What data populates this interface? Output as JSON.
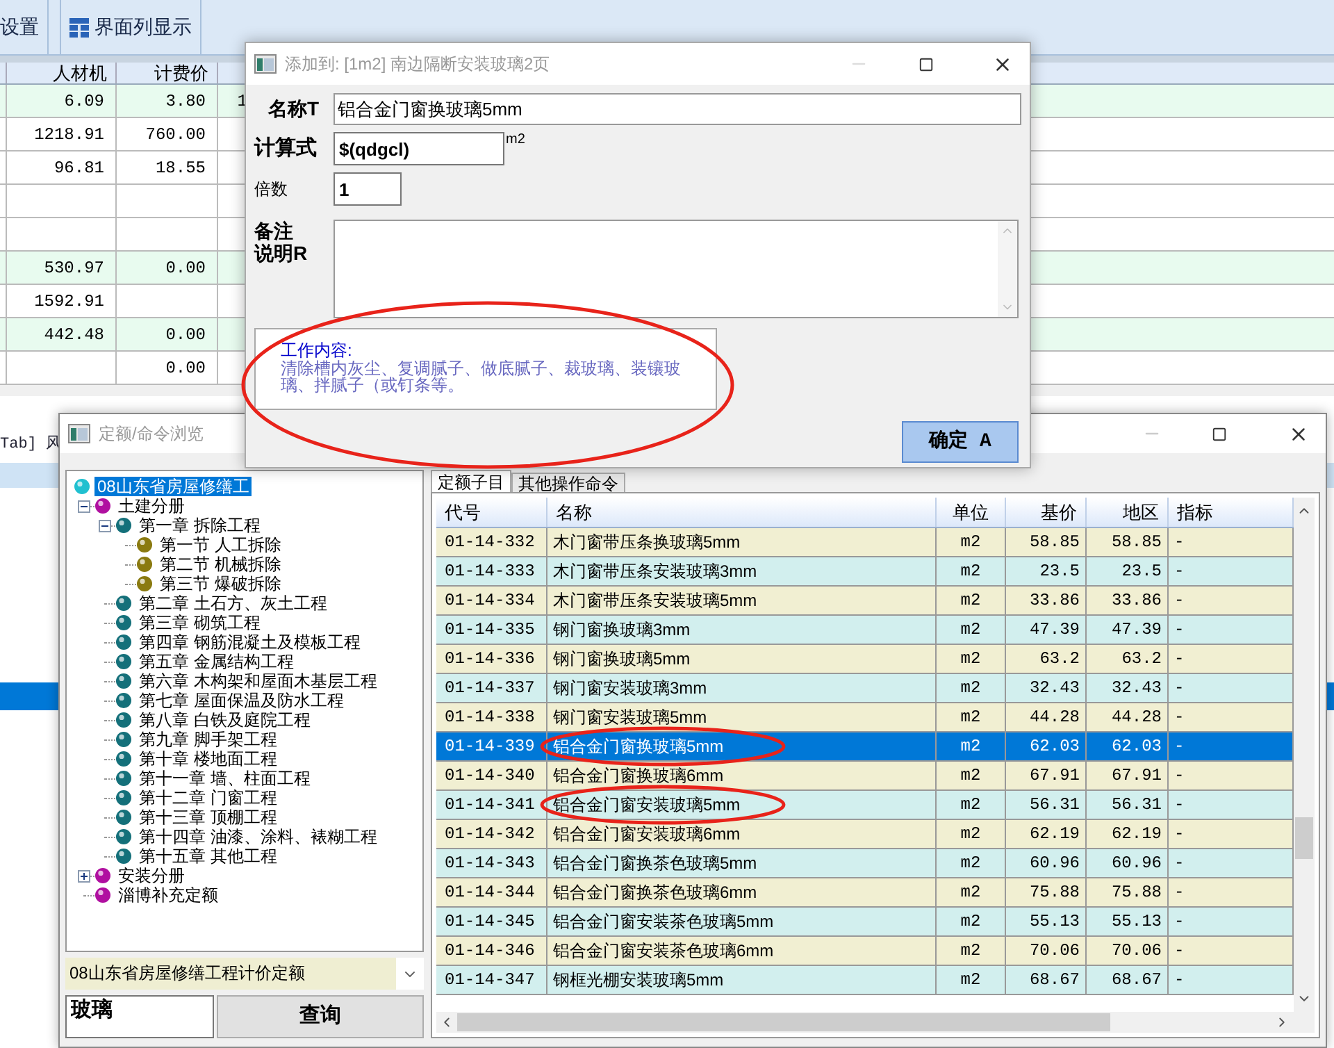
{
  "background_app": {
    "toolbar": [
      {
        "label": "设置",
        "kind": "text"
      },
      {
        "label": "界面列显示",
        "kind": "grid"
      }
    ],
    "grid": {
      "columns": [
        "人材机",
        "计费价"
      ],
      "rows": [
        {
          "cells": [
            "6.09",
            "3.80",
            "1"
          ],
          "shaded": true
        },
        {
          "cells": [
            "1218.91",
            "760.00",
            ""
          ],
          "shaded": false
        },
        {
          "cells": [
            "96.81",
            "18.55",
            ""
          ],
          "shaded": false
        },
        {
          "cells": [
            "",
            "",
            ""
          ],
          "shaded": false
        },
        {
          "cells": [
            "",
            "",
            ""
          ],
          "shaded": false
        },
        {
          "cells": [
            "530.97",
            "0.00",
            ""
          ],
          "shaded": true
        },
        {
          "cells": [
            "1592.91",
            "",
            ""
          ],
          "shaded": false
        },
        {
          "cells": [
            "442.48",
            "0.00",
            ""
          ],
          "shaded": true
        },
        {
          "cells": [
            "",
            "0.00",
            ""
          ],
          "shaded": false
        }
      ]
    },
    "lower_panel": {
      "label": "Tab] 风"
    }
  },
  "dialog": {
    "title": "添加到: [1m2] 南边隔断安装玻璃2页",
    "name_label": "名称T",
    "name_value": "铝合金门窗换玻璃5mm",
    "formula_label": "计算式",
    "formula_value": "$(qdgcl)",
    "unit": "m2",
    "multiplier_label": "倍数",
    "multiplier_value": "1",
    "remark_label": [
      "备注",
      "说明R"
    ],
    "work_content": {
      "heading": "工作内容:",
      "text": "清除槽内灰尘、复调腻子、做底腻子、裁玻璃、装镶玻璃、拌腻子（或钉条等。",
      "circled": true
    },
    "ok_button": "确定 A"
  },
  "browser": {
    "title": "定额/命令浏览",
    "tree": {
      "items": [
        {
          "label": "08山东省房屋修缮工",
          "selected": true,
          "children": [
            {
              "label": "土建分册",
              "selected": false,
              "expanded": true,
              "children": [
                {
                  "label": "第一章  拆除工程",
                  "selected": false,
                  "expanded": true,
                  "children": [
                    {
                      "label": "第一节  人工拆除",
                      "selected": false
                    },
                    {
                      "label": "第二节  机械拆除",
                      "selected": false
                    },
                    {
                      "label": "第三节  爆破拆除",
                      "selected": false
                    }
                  ]
                },
                {
                  "label": "第二章  土石方、灰土工程",
                  "selected": false
                },
                {
                  "label": "第三章  砌筑工程",
                  "selected": false
                },
                {
                  "label": "第四章  钢筋混凝土及模板工程",
                  "selected": false
                },
                {
                  "label": "第五章  金属结构工程",
                  "selected": false
                },
                {
                  "label": "第六章  木构架和屋面木基层工程",
                  "selected": false
                },
                {
                  "label": "第七章  屋面保温及防水工程",
                  "selected": false
                },
                {
                  "label": "第八章  白铁及庭院工程",
                  "selected": false
                },
                {
                  "label": "第九章  脚手架工程",
                  "selected": false
                },
                {
                  "label": "第十章  楼地面工程",
                  "selected": false
                },
                {
                  "label": "第十一章  墙、柱面工程",
                  "selected": false
                },
                {
                  "label": "第十二章  门窗工程",
                  "selected": false
                },
                {
                  "label": "第十三章  顶棚工程",
                  "selected": false
                },
                {
                  "label": "第十四章  油漆、涂料、裱糊工程",
                  "selected": false
                },
                {
                  "label": "第十五章  其他工程",
                  "selected": false
                }
              ]
            },
            {
              "label": "安装分册",
              "selected": false,
              "expanded": false
            },
            {
              "label": "淄博补充定额",
              "selected": false
            }
          ]
        }
      ]
    },
    "library_select": "08山东省房屋修缮工程计价定额",
    "search_value": "玻璃",
    "search_button": "查询",
    "tabs": [
      {
        "label": "定额子目",
        "selected": true
      },
      {
        "label": "其他操作命令",
        "selected": false
      }
    ],
    "table": {
      "columns": [
        "代号",
        "名称",
        "单位",
        "基价",
        "地区",
        "指标"
      ],
      "rows": [
        {
          "cells": [
            "01-14-332",
            "木门窗带压条换玻璃5mm",
            "m2",
            "58.85",
            "58.85",
            "-"
          ],
          "selected": false,
          "circled": false
        },
        {
          "cells": [
            "01-14-333",
            "木门窗带压条安装玻璃3mm",
            "m2",
            "23.5",
            "23.5",
            "-"
          ],
          "selected": false,
          "circled": false
        },
        {
          "cells": [
            "01-14-334",
            "木门窗带压条安装玻璃5mm",
            "m2",
            "33.86",
            "33.86",
            "-"
          ],
          "selected": false,
          "circled": false
        },
        {
          "cells": [
            "01-14-335",
            "钢门窗换玻璃3mm",
            "m2",
            "47.39",
            "47.39",
            "-"
          ],
          "selected": false,
          "circled": false
        },
        {
          "cells": [
            "01-14-336",
            "钢门窗换玻璃5mm",
            "m2",
            "63.2",
            "63.2",
            "-"
          ],
          "selected": false,
          "circled": false
        },
        {
          "cells": [
            "01-14-337",
            "钢门窗安装玻璃3mm",
            "m2",
            "32.43",
            "32.43",
            "-"
          ],
          "selected": false,
          "circled": false
        },
        {
          "cells": [
            "01-14-338",
            "钢门窗安装玻璃5mm",
            "m2",
            "44.28",
            "44.28",
            "-"
          ],
          "selected": false,
          "circled": false
        },
        {
          "cells": [
            "01-14-339",
            "铝合金门窗换玻璃5mm",
            "m2",
            "62.03",
            "62.03",
            "-"
          ],
          "selected": true,
          "circled": true
        },
        {
          "cells": [
            "01-14-340",
            "铝合金门窗换玻璃6mm",
            "m2",
            "67.91",
            "67.91",
            "-"
          ],
          "selected": false,
          "circled": false
        },
        {
          "cells": [
            "01-14-341",
            "铝合金门窗安装玻璃5mm",
            "m2",
            "56.31",
            "56.31",
            "-"
          ],
          "selected": false,
          "circled": true
        },
        {
          "cells": [
            "01-14-342",
            "铝合金门窗安装玻璃6mm",
            "m2",
            "62.19",
            "62.19",
            "-"
          ],
          "selected": false,
          "circled": false
        },
        {
          "cells": [
            "01-14-343",
            "铝合金门窗换茶色玻璃5mm",
            "m2",
            "60.96",
            "60.96",
            "-"
          ],
          "selected": false,
          "circled": false
        },
        {
          "cells": [
            "01-14-344",
            "铝合金门窗换茶色玻璃6mm",
            "m2",
            "75.88",
            "75.88",
            "-"
          ],
          "selected": false,
          "circled": false
        },
        {
          "cells": [
            "01-14-345",
            "铝合金门窗安装茶色玻璃5mm",
            "m2",
            "55.13",
            "55.13",
            "-"
          ],
          "selected": false,
          "circled": false
        },
        {
          "cells": [
            "01-14-346",
            "铝合金门窗安装茶色玻璃6mm",
            "m2",
            "70.06",
            "70.06",
            "-"
          ],
          "selected": false,
          "circled": false
        },
        {
          "cells": [
            "01-14-347",
            "钢框光棚安装玻璃5mm",
            "m2",
            "68.67",
            "68.67",
            "-"
          ],
          "selected": false,
          "circled": false
        }
      ]
    }
  }
}
